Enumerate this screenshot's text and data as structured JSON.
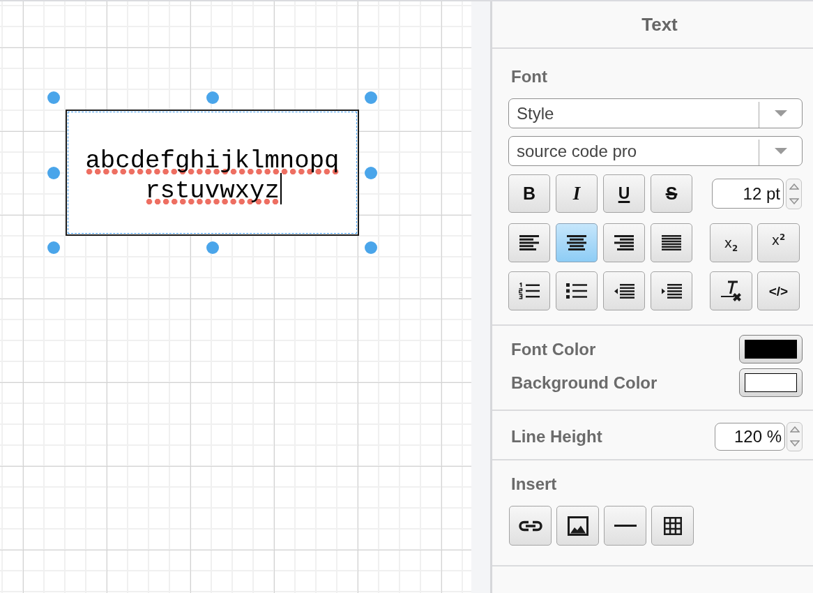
{
  "canvas": {
    "shape": {
      "selected": true,
      "editing": true,
      "lines": [
        {
          "text": "abcdefghijklmnopq",
          "misspelled": true
        },
        {
          "text": "rstuvwxyz",
          "misspelled": true
        }
      ]
    }
  },
  "panel": {
    "title": "Text",
    "font": {
      "label": "Font",
      "style_dropdown": {
        "value": "Style"
      },
      "font_dropdown": {
        "value": "source code pro"
      },
      "style_buttons": [
        {
          "kind": "bold",
          "label": "B",
          "selected": false
        },
        {
          "kind": "italic",
          "label": "I",
          "selected": false
        },
        {
          "kind": "underline",
          "label": "U",
          "selected": false
        },
        {
          "kind": "strikethrough",
          "label": "S",
          "selected": false
        }
      ],
      "size_field": {
        "value": "12 pt"
      },
      "align_buttons": [
        {
          "kind": "left",
          "selected": false
        },
        {
          "kind": "center",
          "selected": true
        },
        {
          "kind": "right",
          "selected": false
        },
        {
          "kind": "justify",
          "selected": false
        }
      ],
      "script_buttons": [
        {
          "kind": "subscript",
          "label": "x$_{2}$",
          "selected": false
        },
        {
          "kind": "superscript",
          "label": "x$^{2}$",
          "selected": false
        }
      ],
      "list_buttons": [
        {
          "kind": "numbered"
        },
        {
          "kind": "bulleted"
        },
        {
          "kind": "outdent"
        },
        {
          "kind": "indent"
        }
      ],
      "tool_buttons": [
        {
          "kind": "clear-formatting"
        },
        {
          "kind": "html",
          "label": "</>"
        }
      ]
    },
    "colors": [
      {
        "label": "Font Color",
        "color": "#000000"
      },
      {
        "label": "Background Color",
        "color": "#ffffff"
      }
    ],
    "line_height": {
      "label": "Line Height",
      "value": "120 %"
    },
    "insert": {
      "label": "Insert",
      "buttons": [
        {
          "kind": "link"
        },
        {
          "kind": "image"
        },
        {
          "kind": "horizontal-rule"
        },
        {
          "kind": "table"
        }
      ]
    }
  }
}
